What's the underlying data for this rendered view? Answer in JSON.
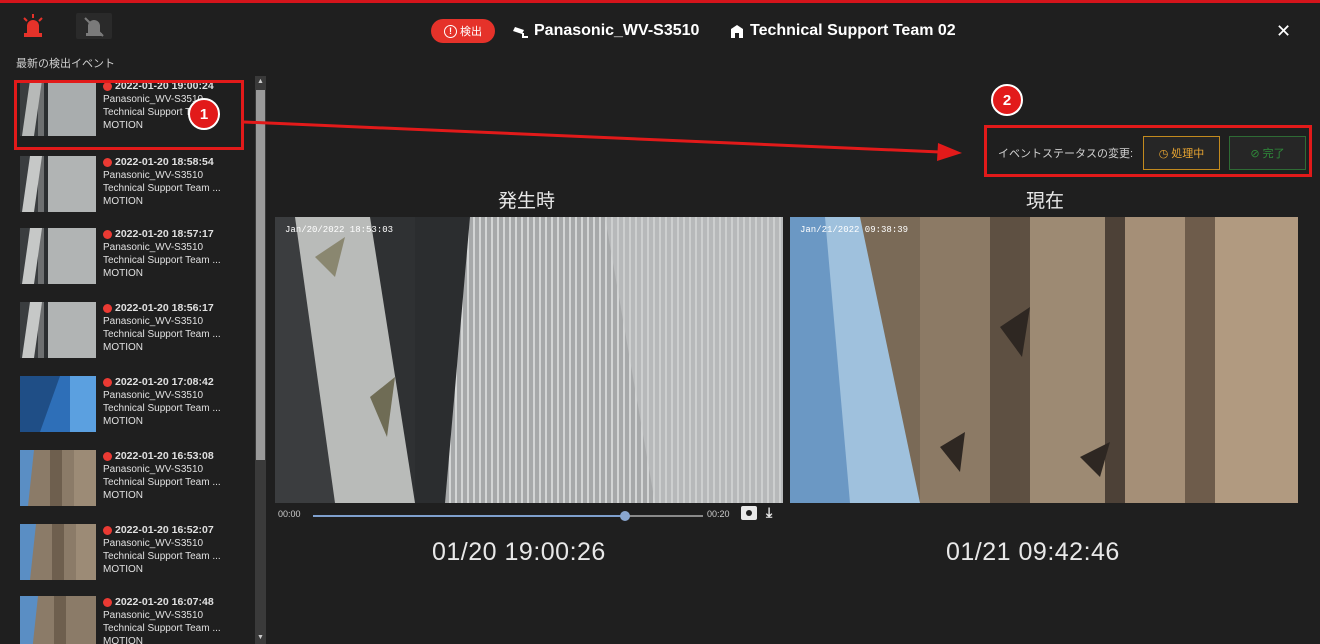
{
  "header": {
    "detect_badge": "検出",
    "camera_name": "Panasonic_WV-S3510",
    "team_name": "Technical Support Team 02",
    "close_label": "✕"
  },
  "sidebar": {
    "title": "最新の検出イベント",
    "events": [
      {
        "time": "2022-01-20 19:00:24",
        "camera": "Panasonic_WV-S3510",
        "team": "Technical Support Team ...",
        "type": "MOTION"
      },
      {
        "time": "2022-01-20 18:58:54",
        "camera": "Panasonic_WV-S3510",
        "team": "Technical Support Team ...",
        "type": "MOTION"
      },
      {
        "time": "2022-01-20 18:57:17",
        "camera": "Panasonic_WV-S3510",
        "team": "Technical Support Team ...",
        "type": "MOTION"
      },
      {
        "time": "2022-01-20 18:56:17",
        "camera": "Panasonic_WV-S3510",
        "team": "Technical Support Team ...",
        "type": "MOTION"
      },
      {
        "time": "2022-01-20 17:08:42",
        "camera": "Panasonic_WV-S3510",
        "team": "Technical Support Team ...",
        "type": "MOTION"
      },
      {
        "time": "2022-01-20 16:53:08",
        "camera": "Panasonic_WV-S3510",
        "team": "Technical Support Team ...",
        "type": "MOTION"
      },
      {
        "time": "2022-01-20 16:52:07",
        "camera": "Panasonic_WV-S3510",
        "team": "Technical Support Team ...",
        "type": "MOTION"
      },
      {
        "time": "2022-01-20 16:07:48",
        "camera": "Panasonic_WV-S3510",
        "team": "Technical Support Team ...",
        "type": "MOTION"
      }
    ]
  },
  "annotations": {
    "marker_1": "1",
    "marker_2": "2",
    "color": "#e21a1a"
  },
  "status": {
    "label": "イベントステータスの変更:",
    "processing_label": "処理中",
    "done_label": "完了"
  },
  "panels": {
    "left_title": "発生時",
    "right_title": "現在",
    "left_osd": "Jan/20/2022 18:53:03",
    "right_osd": "Jan/21/2022 09:38:39",
    "left_timestamp": "01/20 19:00:26",
    "right_timestamp": "01/21 09:42:46"
  },
  "player": {
    "start": "00:00",
    "end": "00:20",
    "progress": 0.8
  },
  "colors": {
    "accent_red": "#d4141b",
    "processing": "#e7a431",
    "done": "#2f8c3a",
    "track": "#7fa0ce"
  }
}
